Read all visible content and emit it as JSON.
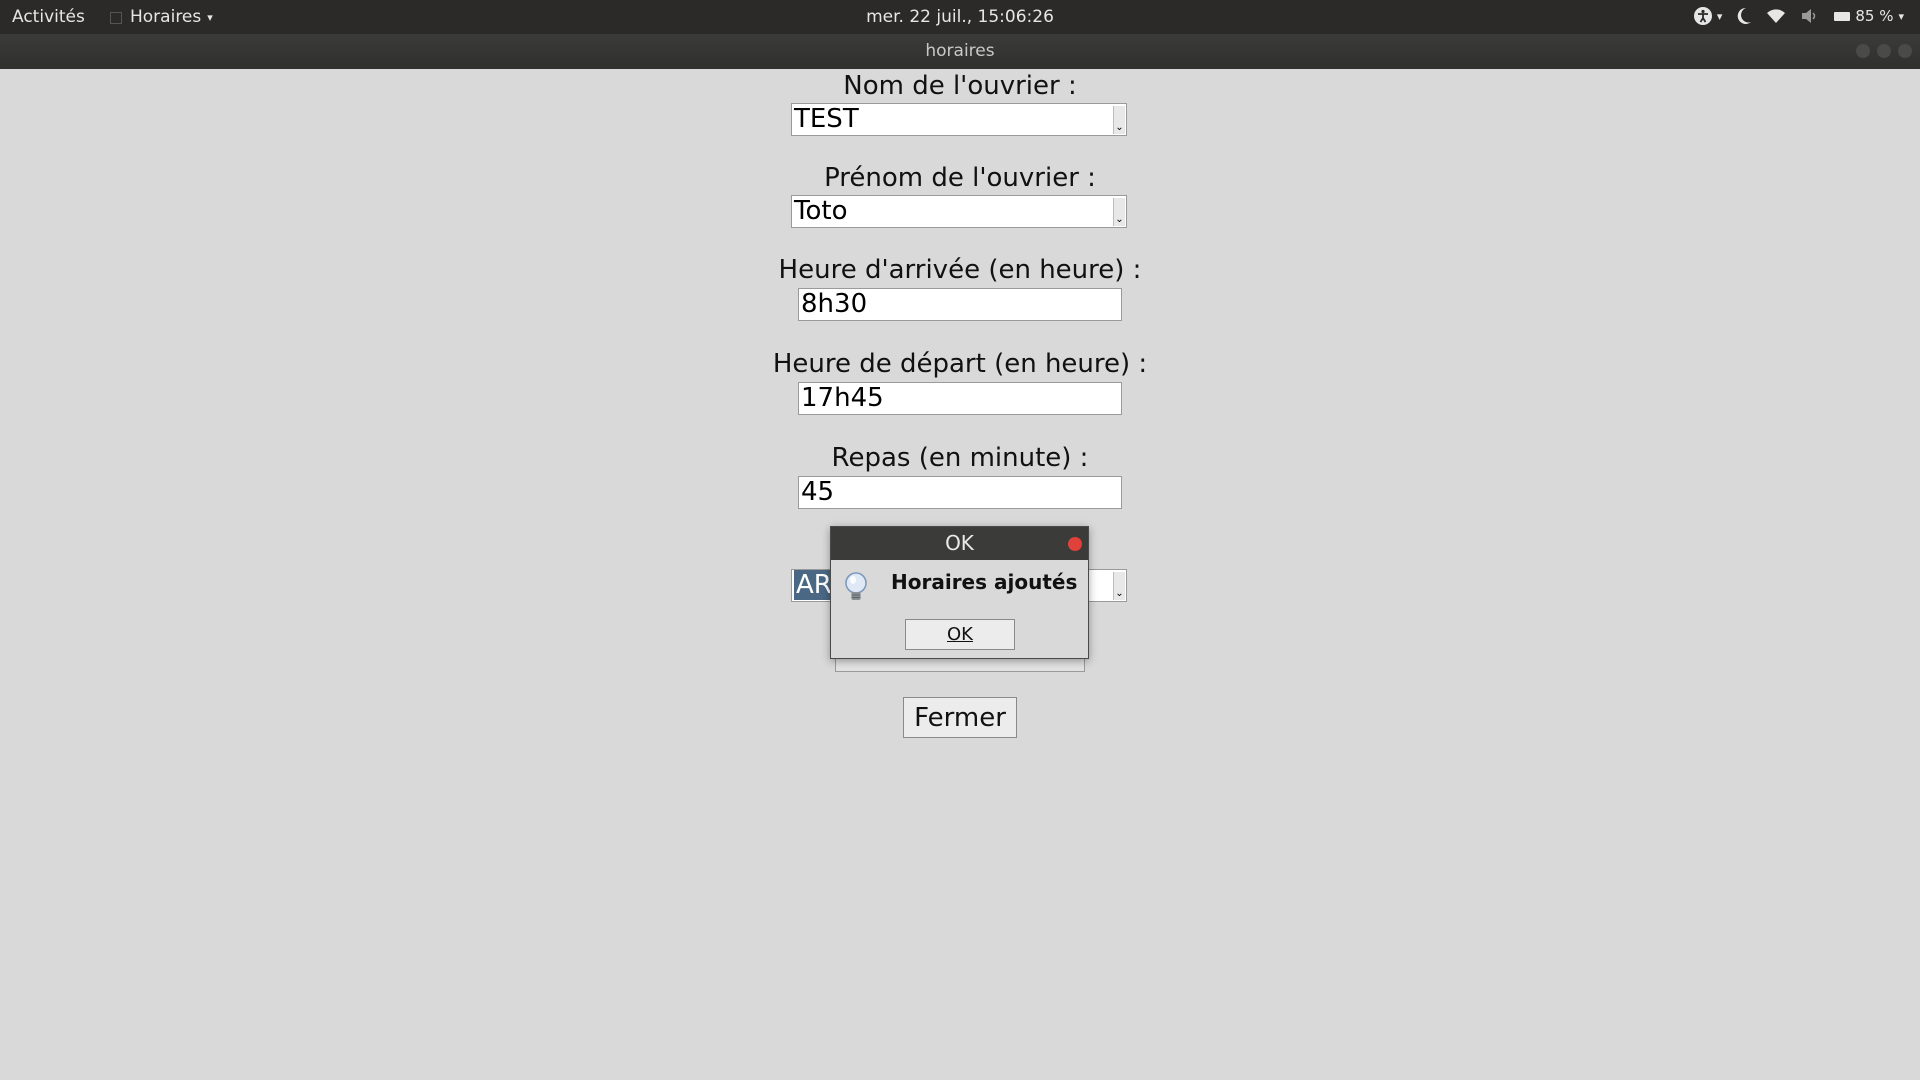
{
  "topbar": {
    "activities": "Activités",
    "app_menu": "Horaires",
    "clock": "mer. 22 juil., 15:06:26",
    "battery": "85 %",
    "icons": [
      "accessibility-icon",
      "night-light-icon",
      "wifi-icon",
      "volume-icon",
      "battery-icon"
    ]
  },
  "window": {
    "title": "horaires"
  },
  "form": {
    "nom_label": "Nom de l'ouvrier :",
    "nom_value": "TEST",
    "prenom_label": "Prénom de l'ouvrier :",
    "prenom_value": "Toto",
    "arrivee_label": "Heure d'arrivée (en heure) :",
    "arrivee_value": "8h30",
    "depart_label": "Heure de départ (en heure) :",
    "depart_value": "17h45",
    "repas_label": "Repas (en minute) :",
    "repas_value": "45",
    "type_value": "AR",
    "fermer_label": "Fermer"
  },
  "dialog": {
    "title": "OK",
    "message": "Horaires ajoutés",
    "ok_label": "OK"
  }
}
